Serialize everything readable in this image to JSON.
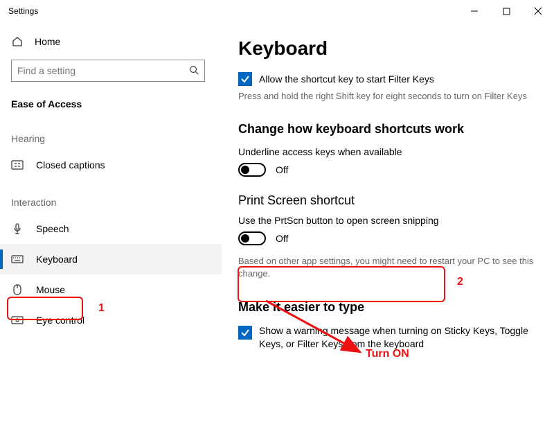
{
  "window": {
    "title": "Settings"
  },
  "sidebar": {
    "home": "Home",
    "search_placeholder": "Find a setting",
    "section": "Ease of Access",
    "groups": {
      "hearing": {
        "label": "Hearing",
        "items": [
          {
            "label": "Closed captions"
          }
        ]
      },
      "interaction": {
        "label": "Interaction",
        "items": [
          {
            "label": "Speech"
          },
          {
            "label": "Keyboard",
            "selected": true
          },
          {
            "label": "Mouse"
          },
          {
            "label": "Eye control"
          }
        ]
      }
    }
  },
  "content": {
    "heading": "Keyboard",
    "filter_keys_checkbox": "Allow the shortcut key to start Filter Keys",
    "filter_keys_help": "Press and hold the right Shift key for eight seconds to turn on Filter Keys",
    "section_shortcuts": "Change how keyboard shortcuts work",
    "underline_label": "Underline access keys when available",
    "underline_state": "Off",
    "section_printscreen": "Print Screen shortcut",
    "prtscn_label": "Use the PrtScn button to open screen snipping",
    "prtscn_state": "Off",
    "prtscn_help": "Based on other app settings, you might need to restart your PC to see this change.",
    "section_easier": "Make it easier to type",
    "warning_checkbox": "Show a warning message when turning on Sticky Keys, Toggle Keys, or Filter Keys from the keyboard"
  },
  "annotations": {
    "num1": "1",
    "num2": "2",
    "turn_on": "Turn ON"
  }
}
